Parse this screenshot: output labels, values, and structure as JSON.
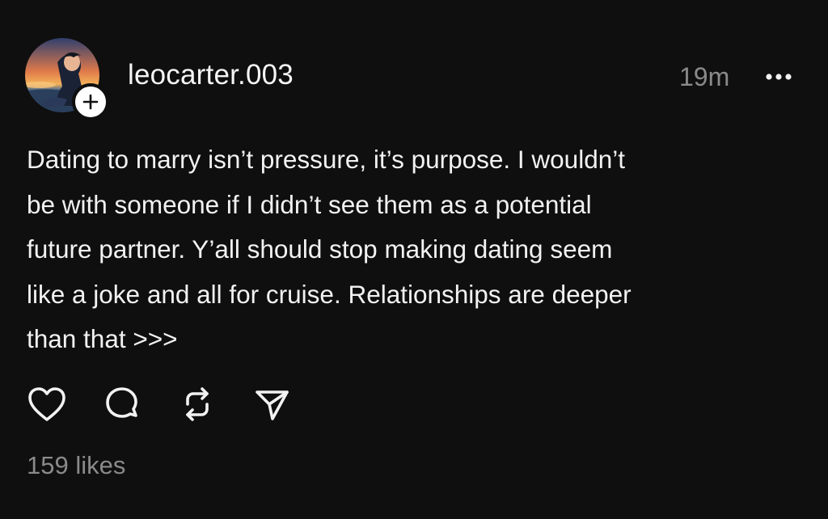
{
  "post": {
    "username": "leocarter.003",
    "timestamp": "19m",
    "text": "Dating to marry isn’t pressure, it’s purpose. I wouldn’t\nbe with someone if I didn’t see them as a potential\nfuture partner. Y’all should stop making dating seem\nlike a joke and all for cruise. Relationships are deeper\nthan that >>>",
    "likes": "159 likes"
  },
  "icons": {
    "follow": "plus-icon",
    "more": "more-horizontal-icon",
    "like": "heart-icon",
    "comment": "comment-icon",
    "repost": "repost-icon",
    "share": "send-icon"
  },
  "colors": {
    "background": "#0f0f0f",
    "text": "#f2f2f2",
    "muted": "#8a8a8a"
  }
}
